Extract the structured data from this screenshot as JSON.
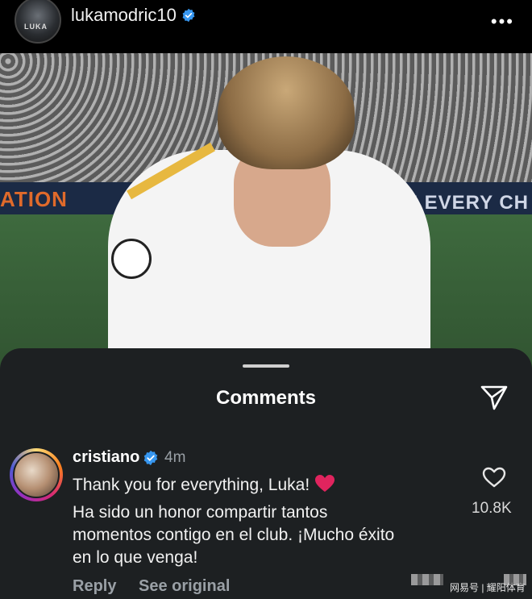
{
  "post": {
    "username": "lukamodric10",
    "avatar_text": "LUKA",
    "more_icon": "more-horizontal-icon",
    "photo": {
      "board_left_text": "ATION",
      "board_right_text": "USE EVERY CH"
    }
  },
  "comments_sheet": {
    "title": "Comments",
    "comment": {
      "username": "cristiano",
      "time": "4m",
      "line1": "Thank you for everything, Luka!",
      "body": " Ha sido un honor compartir tantos\nmomentos contigo en el club. ¡Mucho éxito\nen lo que venga!",
      "like_count": "10.8K",
      "reply_label": "Reply",
      "see_original_label": "See original"
    }
  },
  "watermark": {
    "text": "网易号 | 耀阳体育"
  },
  "colors": {
    "verified_blue": "#3797f0",
    "sheet_bg": "#1d2022",
    "heart_red": "#e0245e"
  }
}
